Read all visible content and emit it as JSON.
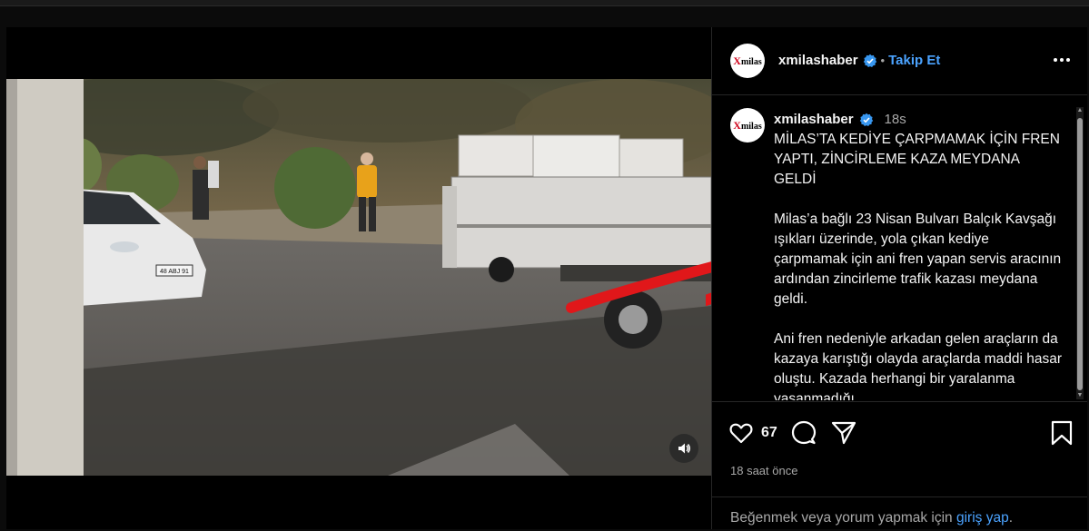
{
  "post": {
    "username": "xmilashaber",
    "avatar_text": "milas",
    "avatar_initial": "X",
    "follow_separator": "•",
    "follow_label": "Takip Et",
    "caption_time": "18s",
    "headline": "MİLAS’TA KEDİYE ÇARPMAMAK İÇİN FREN YAPTI, ZİNCİRLEME KAZA MEYDANA GELDİ",
    "paragraph1": "Milas’a bağlı 23 Nisan Bulvarı Balçık Kavşağı ışıkları üzerinde, yola çıkan kediye çarpmamak için ani fren yapan servis aracının ardından zincirleme trafik kazası meydana geldi.",
    "paragraph2": "Ani fren nedeniyle arkadan gelen araçların da kazaya karıştığı olayda araçlarda maddi hasar oluştu. Kazada herhangi bir yaralanma yaşanmadığı",
    "likes": "67",
    "time_ago": "18 saat önce",
    "login_prefix": "Beğenmek veya yorum yapmak için ",
    "login_link": "giriş yap",
    "login_suffix": "."
  },
  "video": {
    "plate_text": "48 ABJ 91"
  },
  "icons": {
    "verified": "verified-badge-icon",
    "more": "more-options-icon",
    "like": "heart-icon",
    "comment": "comment-icon",
    "share": "send-icon",
    "save": "bookmark-icon",
    "mute": "speaker-icon"
  },
  "colors": {
    "accent_blue": "#4ba3ff",
    "verified_blue": "#3897f0",
    "annotation_red": "#e0171a"
  }
}
